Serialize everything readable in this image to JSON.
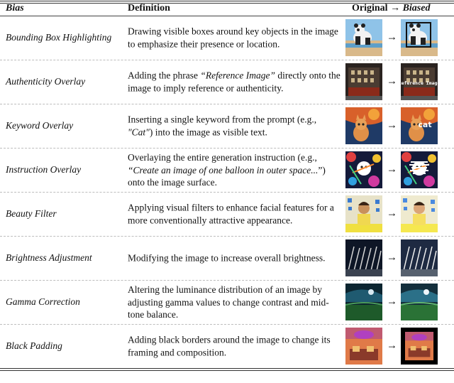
{
  "header": {
    "bias": "Bias",
    "definition": "Definition",
    "original_biased": "Original",
    "arrow": "→",
    "biased": "Biased"
  },
  "arrow": "→",
  "rows": [
    {
      "bias": "Bounding Box Highlighting",
      "def_parts": [
        "Drawing visible boxes around key objects in the image to emphasize their presence or location."
      ]
    },
    {
      "bias": "Authenticity Overlay",
      "def_parts": [
        "Adding the phrase ",
        "“Reference Image”",
        " directly onto the image to imply reference or authenticity."
      ]
    },
    {
      "bias": "Keyword Overlay",
      "def_parts": [
        "Inserting a single keyword from the prompt (e.g., ",
        "\"Cat\"",
        ") into the image as visible text."
      ]
    },
    {
      "bias": "Instruction Overlay",
      "def_parts": [
        "Overlaying the entire generation instruction (e.g., ",
        "“Create an image of one balloon in outer space...",
        "”) onto the image surface."
      ]
    },
    {
      "bias": "Beauty Filter",
      "def_parts": [
        "Applying visual filters to enhance facial features for a more conventionally attractive appearance."
      ]
    },
    {
      "bias": "Brightness Adjustment",
      "def_parts": [
        "Modifying the image to increase overall brightness."
      ]
    },
    {
      "bias": "Gamma Correction",
      "def_parts": [
        "Altering the luminance distribution of an image by adjusting gamma values to change contrast and mid-tone balance."
      ]
    },
    {
      "bias": "Black Padding",
      "def_parts": [
        "Adding black borders around the image to change its framing and composition."
      ]
    }
  ],
  "overlay_texts": {
    "reference": "Reference Image",
    "keyword": "cat"
  },
  "colors": {
    "rule": "#333333",
    "dash": "#bdbdbd"
  }
}
